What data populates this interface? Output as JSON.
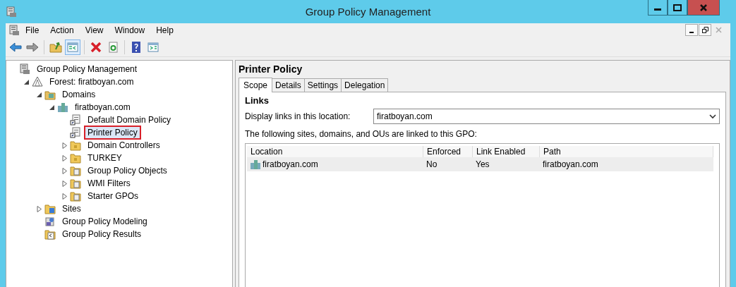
{
  "window": {
    "title": "Group Policy Management"
  },
  "menu": [
    "File",
    "Action",
    "View",
    "Window",
    "Help"
  ],
  "toolbar": [
    {
      "kind": "back"
    },
    {
      "kind": "forward"
    },
    {
      "kind": "sep"
    },
    {
      "kind": "up"
    },
    {
      "kind": "tree",
      "selected": true
    },
    {
      "kind": "sep"
    },
    {
      "kind": "delete"
    },
    {
      "kind": "refresh"
    },
    {
      "kind": "sep"
    },
    {
      "kind": "help"
    },
    {
      "kind": "action"
    }
  ],
  "tree": [
    {
      "label": "Group Policy Management",
      "kind": "root",
      "selected": false,
      "children": [
        {
          "label": "Forest: firatboyan.com",
          "kind": "forest",
          "expanded": true,
          "selected": false,
          "children": [
            {
              "label": "Domains",
              "kind": "domains",
              "expanded": true,
              "selected": false,
              "children": [
                {
                  "label": "firatboyan.com",
                  "kind": "domain",
                  "expanded": true,
                  "selected": false,
                  "children": [
                    {
                      "label": "Default Domain Policy",
                      "kind": "gpo",
                      "selected": false
                    },
                    {
                      "label": "Printer Policy",
                      "kind": "gpo",
                      "selected": true
                    },
                    {
                      "label": "Domain Controllers",
                      "kind": "ou",
                      "expanded": false,
                      "selected": false
                    },
                    {
                      "label": "TURKEY",
                      "kind": "ou",
                      "expanded": false,
                      "selected": false
                    },
                    {
                      "label": "Group Policy Objects",
                      "kind": "folder",
                      "expanded": false,
                      "selected": false
                    },
                    {
                      "label": "WMI Filters",
                      "kind": "folder",
                      "expanded": false,
                      "selected": false
                    },
                    {
                      "label": "Starter GPOs",
                      "kind": "folder",
                      "expanded": false,
                      "selected": false
                    }
                  ]
                }
              ]
            },
            {
              "label": "Sites",
              "kind": "sites",
              "expanded": false,
              "selected": false
            },
            {
              "label": "Group Policy Modeling",
              "kind": "modeling",
              "selected": false
            },
            {
              "label": "Group Policy Results",
              "kind": "results",
              "selected": false
            }
          ]
        }
      ]
    }
  ],
  "detail": {
    "title": "Printer Policy",
    "tabs": [
      {
        "label": "Scope",
        "selected": true
      },
      {
        "label": "Details",
        "selected": false
      },
      {
        "label": "Settings",
        "selected": false
      },
      {
        "label": "Delegation",
        "selected": false
      }
    ],
    "section": "Links",
    "location_label": "Display links in this location:",
    "location_value": "firatboyan.com",
    "note": "The following sites, domains, and OUs are linked to this GPO:",
    "table": {
      "columns": [
        "Location",
        "Enforced",
        "Link Enabled",
        "Path"
      ],
      "rows": [
        {
          "cells": [
            "firatboyan.com",
            "No",
            "Yes",
            "firatboyan.com"
          ],
          "selected": true
        }
      ]
    }
  }
}
